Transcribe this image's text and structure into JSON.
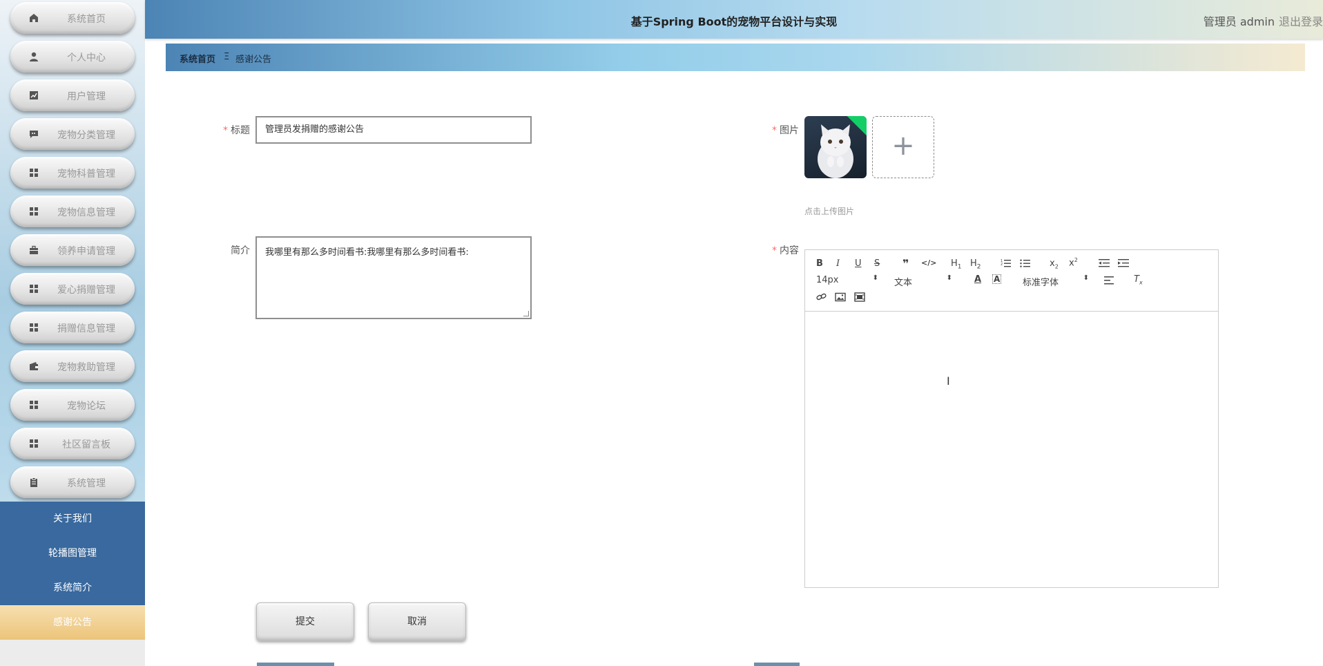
{
  "header": {
    "title": "基于Spring Boot的宠物平台设计与实现",
    "user": "管理员 admin",
    "logout": "退出登录"
  },
  "sidebar": {
    "items": [
      {
        "label": "系统首页",
        "icon": "home-icon"
      },
      {
        "label": "个人中心",
        "icon": "user-icon"
      },
      {
        "label": "用户管理",
        "icon": "chart-icon"
      },
      {
        "label": "宠物分类管理",
        "icon": "chat-icon"
      },
      {
        "label": "宠物科普管理",
        "icon": "grid-icon"
      },
      {
        "label": "宠物信息管理",
        "icon": "grid-icon"
      },
      {
        "label": "领养申请管理",
        "icon": "briefcase-icon"
      },
      {
        "label": "爱心捐赠管理",
        "icon": "grid-icon"
      },
      {
        "label": "捐赠信息管理",
        "icon": "grid-icon"
      },
      {
        "label": "宠物救助管理",
        "icon": "wallet-icon"
      },
      {
        "label": "宠物论坛",
        "icon": "grid-icon"
      },
      {
        "label": "社区留言板",
        "icon": "grid-icon"
      },
      {
        "label": "系统管理",
        "icon": "clipboard-icon"
      }
    ],
    "submenu": [
      "关于我们",
      "轮播图管理",
      "系统简介",
      "感谢公告"
    ],
    "active_submenu": "感谢公告"
  },
  "breadcrumb": {
    "home": "系统首页",
    "separator": "Ξ",
    "current": "感谢公告"
  },
  "form": {
    "title_label": "标题",
    "title_value": "管理员发捐赠的感谢公告",
    "intro_label": "简介",
    "intro_value": "我哪里有那么多时间看书:我哪里有那么多时间看书:",
    "image_label": "图片",
    "upload_tip": "点击上传图片",
    "content_label": "内容",
    "required_mark": "*"
  },
  "editor": {
    "font_size": "14px",
    "header_select": "文本",
    "font_family": "标准字体"
  },
  "buttons": {
    "submit": "提交",
    "cancel": "取消"
  },
  "colors": {
    "sidebar_submenu": "#39699e",
    "active_submenu": "#ecc47a",
    "required": "#f56c6c",
    "image_badge": "#13ce66"
  }
}
